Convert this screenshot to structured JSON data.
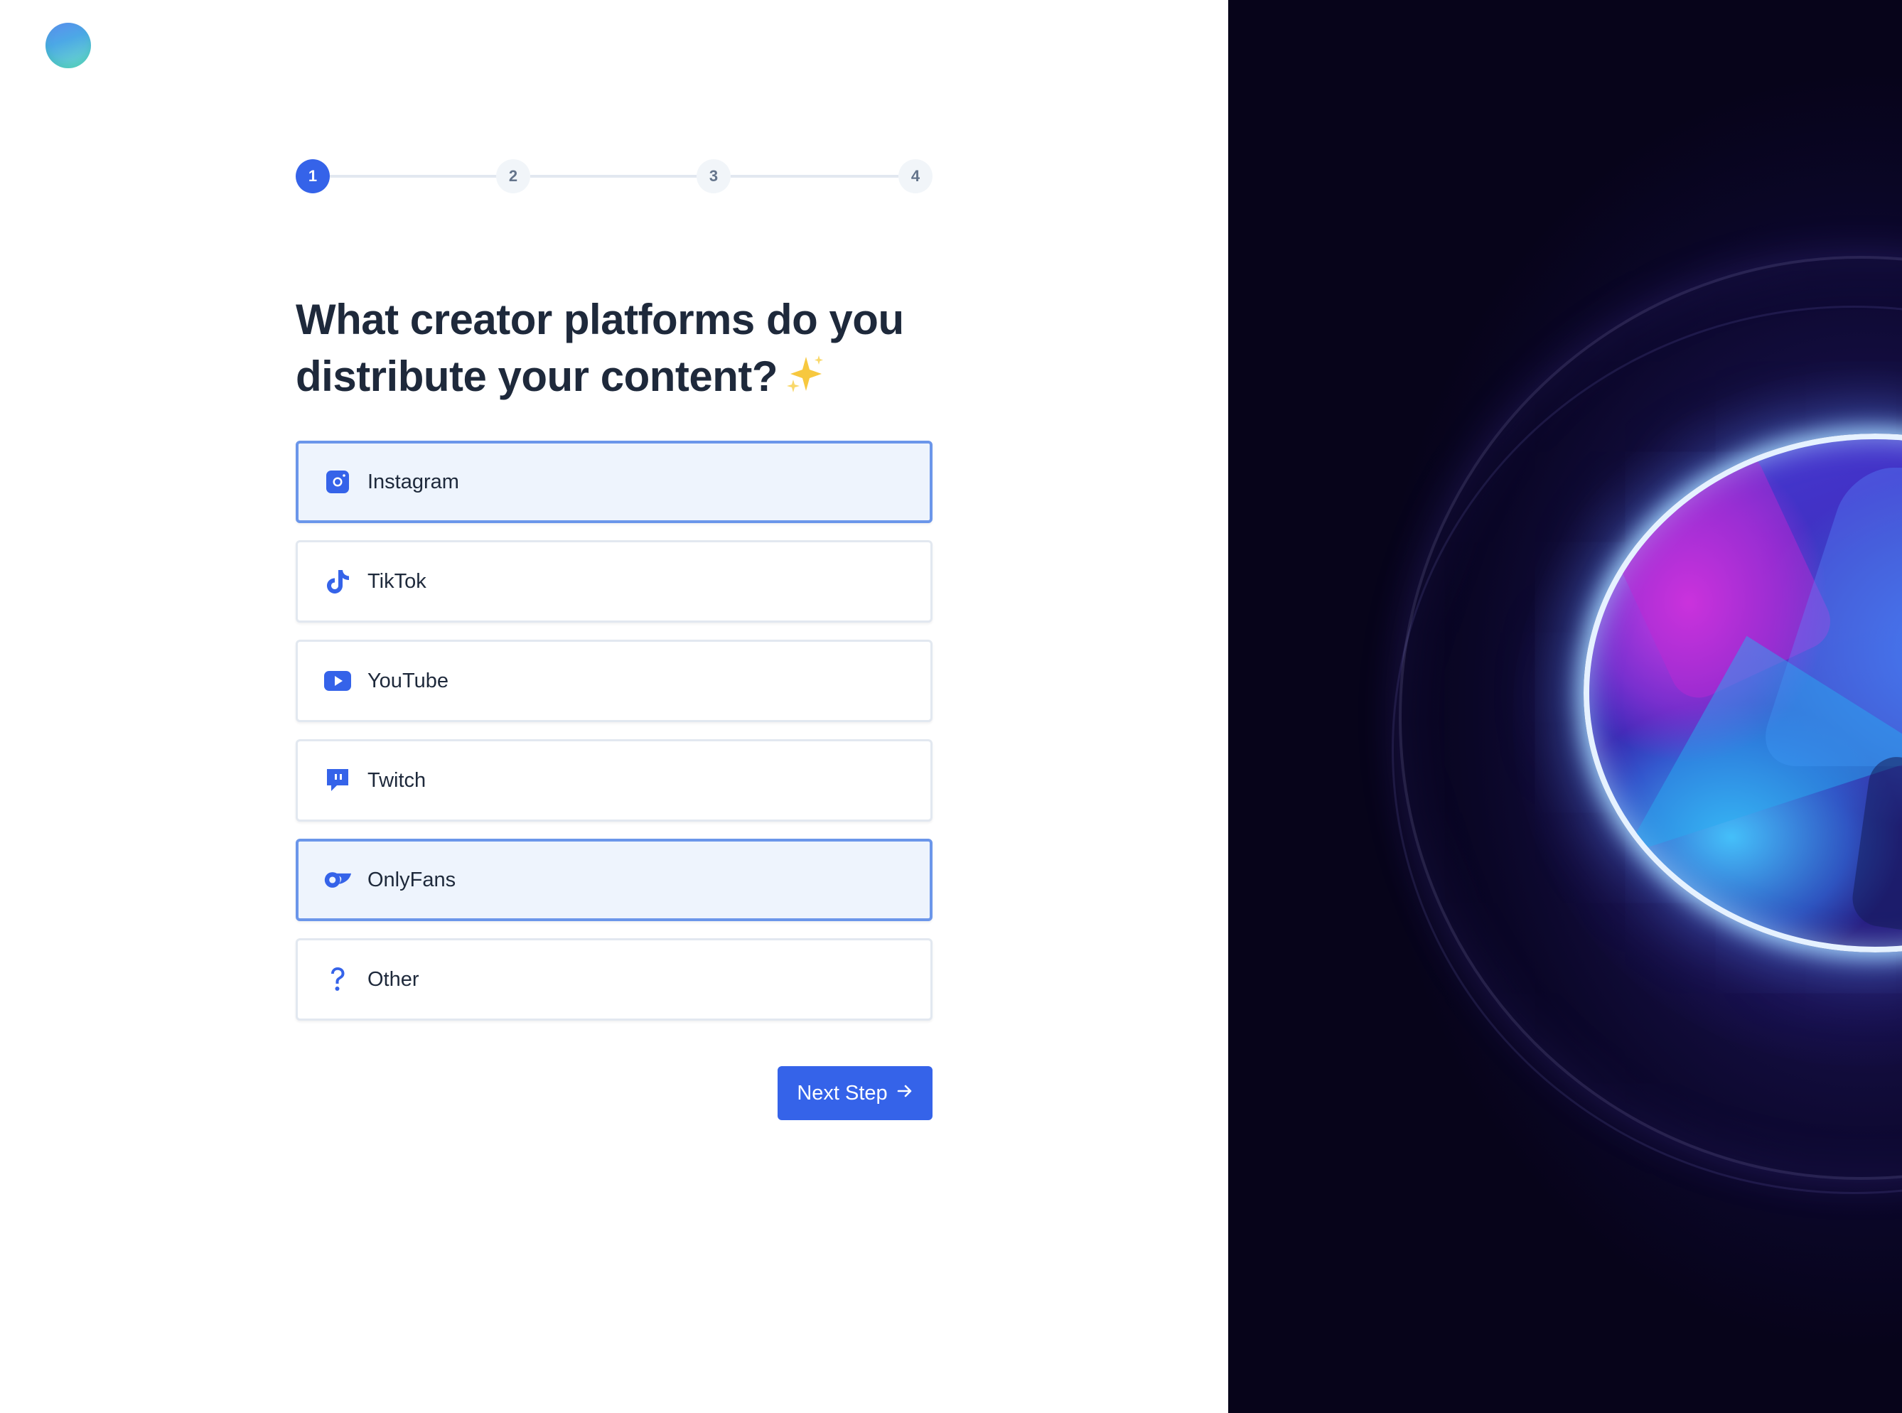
{
  "stepper": {
    "steps": [
      {
        "label": "1",
        "state": "active"
      },
      {
        "label": "2",
        "state": "inactive"
      },
      {
        "label": "3",
        "state": "inactive"
      },
      {
        "label": "4",
        "state": "inactive"
      }
    ]
  },
  "heading": {
    "text": "What creator platforms do you distribute your content?",
    "emoji_icon": "sparkles-icon"
  },
  "options": [
    {
      "label": "Instagram",
      "icon": "instagram-icon",
      "selected": true
    },
    {
      "label": "TikTok",
      "icon": "tiktok-icon",
      "selected": false
    },
    {
      "label": "YouTube",
      "icon": "youtube-icon",
      "selected": false
    },
    {
      "label": "Twitch",
      "icon": "twitch-icon",
      "selected": false
    },
    {
      "label": "OnlyFans",
      "icon": "onlyfans-icon",
      "selected": true
    },
    {
      "label": "Other",
      "icon": "question-icon",
      "selected": false
    }
  ],
  "next_button": {
    "label": "Next Step",
    "icon": "arrow-right-icon"
  },
  "colors": {
    "accent": "#3563e9",
    "selected_border": "#6b96ea",
    "selected_bg": "#eef4fd",
    "text": "#1e293b"
  }
}
